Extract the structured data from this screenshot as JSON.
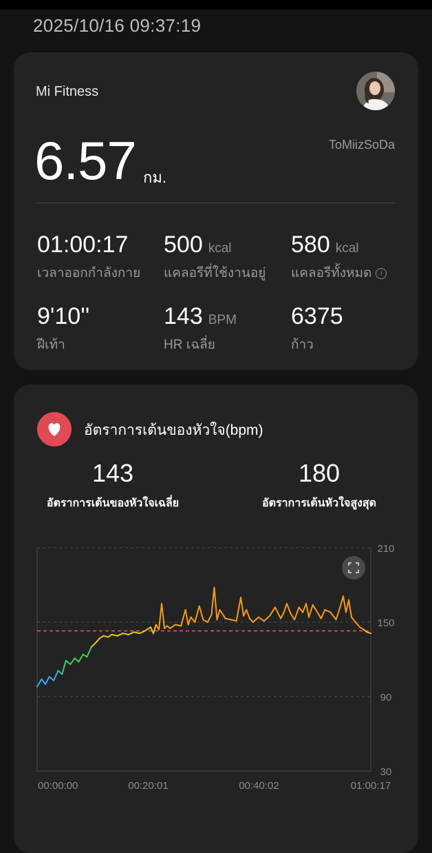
{
  "header": {
    "timestamp": "2025/10/16 09:37:19"
  },
  "summary": {
    "app_name": "Mi Fitness",
    "username": "ToMiizSoDa",
    "distance": "6.57",
    "distance_unit": "กม.",
    "stats": [
      {
        "value": "01:00:17",
        "unit": "",
        "label": "เวลาออกกำลังกาย"
      },
      {
        "value": "500",
        "unit": "kcal",
        "label": "แคลอรีที่ใช้งานอยู่"
      },
      {
        "value": "580",
        "unit": "kcal",
        "label": "แคลอรีทั้งหมด"
      },
      {
        "value": "9'10''",
        "unit": "",
        "label": "ฝีเท้า"
      },
      {
        "value": "143",
        "unit": "BPM",
        "label": "HR เฉลี่ย"
      },
      {
        "value": "6375",
        "unit": "",
        "label": "ก้าว"
      }
    ]
  },
  "heart_rate": {
    "title": "อัตราการเต้นของหัวใจ(bpm)",
    "average": "143",
    "average_label": "อัตราการเต้นของหัวใจเฉลี่ย",
    "max": "180",
    "max_label": "อัตราการเต้นหัวใจสูงสุด"
  },
  "chart_data": {
    "type": "line",
    "x_ticks": [
      "00:00:00",
      "00:20:01",
      "00:40:02",
      "01:00:17"
    ],
    "y_ticks": [
      210,
      150,
      90,
      30
    ],
    "ylim": [
      30,
      210
    ],
    "xlim_minutes": [
      0,
      60.28
    ],
    "average_line": 143,
    "grid": true,
    "colors": {
      "blue": "#3ea8f0",
      "green": "#3ecf5a",
      "yellow": "#f2c21b",
      "orange": "#f59a1c",
      "red": "#ef5462",
      "avg": "#ef5462"
    },
    "series": [
      {
        "x": [
          0,
          0.8,
          1.5,
          2.2,
          3.0,
          3.8,
          4.5,
          5.2,
          6.0,
          6.8,
          7.5,
          8.3,
          9.0,
          9.8,
          10.5,
          11.3,
          12.0,
          12.8,
          13.5,
          14.5,
          15.5,
          16.5,
          17.5,
          18.5,
          19.5,
          20.5,
          21.0,
          21.5,
          22.0,
          22.5,
          23.0,
          23.5,
          24.0,
          25.0,
          26.0,
          26.8,
          27.3,
          27.8,
          28.5,
          29.3,
          30.0,
          30.8,
          31.5,
          32.0,
          32.5,
          33.0,
          34.0,
          35.0,
          36.0,
          36.8,
          37.3,
          37.8,
          38.4,
          39.0,
          40.0,
          41.0,
          42.0,
          43.0,
          44.0,
          44.6,
          45.1,
          45.8,
          46.5,
          47.3,
          48.0,
          48.6,
          49.1,
          49.8,
          50.5,
          51.3,
          52.0,
          53.0,
          54.0,
          54.8,
          55.3,
          55.8,
          56.3,
          56.8,
          57.5,
          58.3,
          59.0,
          59.6,
          60.28
        ],
        "y": [
          98,
          104,
          100,
          106,
          103,
          111,
          108,
          119,
          116,
          121,
          118,
          124,
          122,
          130,
          133,
          137,
          139,
          138,
          140,
          139,
          141,
          140,
          142,
          141,
          143,
          146,
          141,
          148,
          144,
          165,
          145,
          147,
          145,
          148,
          147,
          160,
          148,
          154,
          150,
          163,
          152,
          150,
          156,
          178,
          152,
          160,
          153,
          152,
          151,
          170,
          155,
          160,
          153,
          150,
          154,
          151,
          155,
          162,
          153,
          158,
          165,
          157,
          152,
          162,
          158,
          165,
          154,
          164,
          159,
          153,
          160,
          158,
          152,
          163,
          171,
          158,
          168,
          154,
          150,
          146,
          144,
          142,
          141
        ]
      }
    ]
  }
}
